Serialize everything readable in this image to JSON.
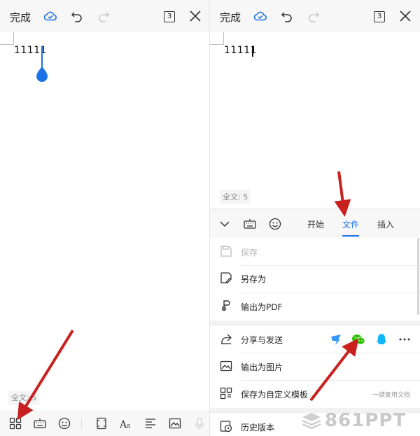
{
  "left": {
    "topbar": {
      "done_label": "完成",
      "page_count": "3"
    },
    "document": {
      "text": "11111"
    },
    "wordcount": "全文: 5",
    "bottom_toolbar_icons": [
      "apps-grid-icon",
      "keyboard-icon",
      "emoji-icon",
      "page-frame-icon",
      "font-style-icon",
      "paragraph-align-icon",
      "image-icon",
      "microphone-icon"
    ]
  },
  "right": {
    "topbar": {
      "done_label": "完成",
      "page_count": "3"
    },
    "document": {
      "text": "11111"
    },
    "wordcount": "全文: 5",
    "tabs": [
      {
        "label": "开始",
        "active": false
      },
      {
        "label": "文件",
        "active": true
      },
      {
        "label": "插入",
        "active": false
      }
    ],
    "menu": {
      "save": "保存",
      "save_as": "另存为",
      "export_pdf": "输出为PDF",
      "share_send": "分享与发送",
      "export_image": "输出为图片",
      "save_template": "保存为自定义模板",
      "save_template_hint": "一键复用文档",
      "history": "历史版本"
    }
  },
  "watermark": {
    "text": "861PPT"
  },
  "colors": {
    "accent": "#1a73e8",
    "arrow": "#c8201e",
    "wechat": "#2dc100",
    "qq": "#12b7f5",
    "dingtalk": "#3296fa"
  }
}
